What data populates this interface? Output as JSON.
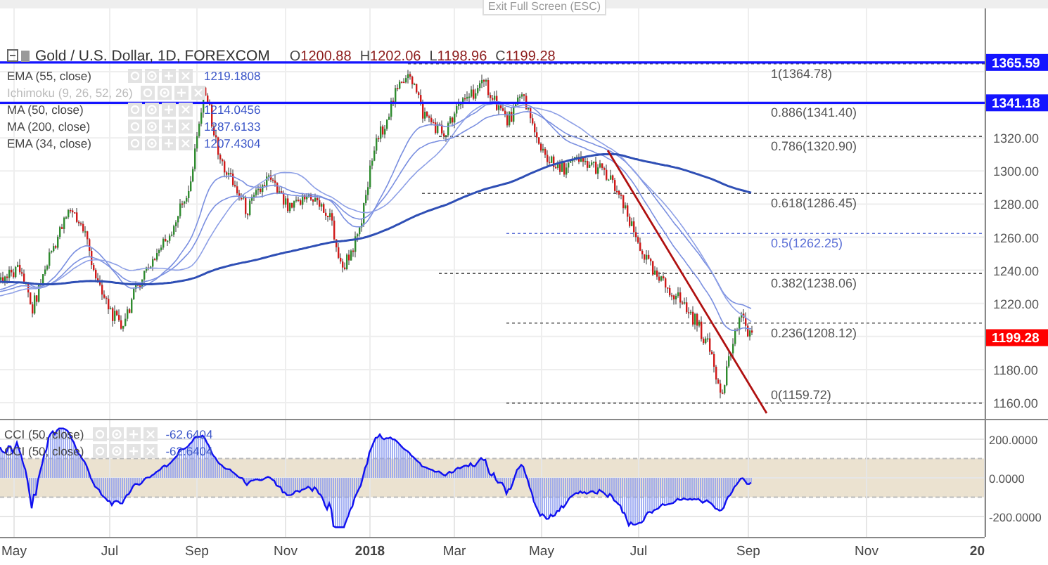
{
  "tooltip": {
    "text": "Exit Full Screen (ESC)"
  },
  "header": {
    "title": "Gold / U.S. Dollar, 1D, FOREXCOM",
    "ohlc": [
      {
        "label": "O",
        "value": "1200.88"
      },
      {
        "label": "H",
        "value": "1202.06"
      },
      {
        "label": "L",
        "value": "1198.96"
      },
      {
        "label": "C",
        "value": "1199.28"
      }
    ]
  },
  "indicators": [
    {
      "label": "EMA (55, close)",
      "value": "1219.1808",
      "hidden": false
    },
    {
      "label": "Ichimoku (9, 26, 52, 26)",
      "hidden": true
    },
    {
      "label": "MA (50, close)",
      "value": "1214.0456",
      "hidden": false
    },
    {
      "label": "MA (200, close)",
      "value": "1287.6133",
      "hidden": false
    },
    {
      "label": "EMA (34, close)",
      "value": "1207.4304",
      "hidden": false
    }
  ],
  "fib_levels": [
    {
      "label": "1(1364.78)",
      "color": "#555555"
    },
    {
      "label": "0.886(1341.40)",
      "color": "#555555"
    },
    {
      "label": "0.786(1320.90)",
      "color": "#555555"
    },
    {
      "label": "0.618(1286.45)",
      "color": "#555555"
    },
    {
      "label": "0.5(1262.25)",
      "color": "#5b6fd6"
    },
    {
      "label": "0.382(1238.06)",
      "color": "#555555"
    },
    {
      "label": "0.236(1208.12)",
      "color": "#555555"
    },
    {
      "label": "0(1159.72)",
      "color": "#555555"
    }
  ],
  "price_axis": [
    "1320.00",
    "1300.00",
    "1280.00",
    "1260.00",
    "1240.00",
    "1220.00",
    "1180.00",
    "1160.00"
  ],
  "price_tags": [
    {
      "value": "1365.59",
      "color": "#1414ff"
    },
    {
      "value": "1341.18",
      "color": "#1414ff"
    },
    {
      "value": "1199.28",
      "color": "#ff0000"
    }
  ],
  "cci": {
    "legend": [
      {
        "label": "CCI (50, close)",
        "value": "-62.6404"
      },
      {
        "label": "CCI (50, close)",
        "value": "-62.6404"
      }
    ],
    "axis": [
      "200.0000",
      "0.0000",
      "-200.0000"
    ]
  },
  "time_axis": [
    {
      "label": "May",
      "bold": false
    },
    {
      "label": "Jul",
      "bold": false
    },
    {
      "label": "Sep",
      "bold": false
    },
    {
      "label": "Nov",
      "bold": false
    },
    {
      "label": "2018",
      "bold": true
    },
    {
      "label": "Mar",
      "bold": false
    },
    {
      "label": "May",
      "bold": false
    },
    {
      "label": "Jul",
      "bold": false
    },
    {
      "label": "Sep",
      "bold": false
    },
    {
      "label": "Nov",
      "bold": false
    },
    {
      "label": "20",
      "bold": true
    }
  ]
}
